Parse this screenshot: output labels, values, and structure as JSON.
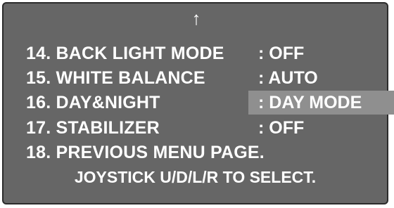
{
  "osd": {
    "scroll_indicator": "↑",
    "items": [
      {
        "label": "14. BACK LIGHT MODE",
        "value": ": OFF"
      },
      {
        "label": "15. WHITE BALANCE",
        "value": ": AUTO"
      },
      {
        "label": "16. DAY&NIGHT",
        "value": ": DAY MODE"
      },
      {
        "label": "17. STABILIZER",
        "value": ": OFF"
      },
      {
        "label": "18. PREVIOUS MENU PAGE.",
        "value": ""
      }
    ],
    "selected_index": 2,
    "hint": "JOYSTICK U/D/L/R TO SELECT."
  },
  "colors": {
    "background": "#666666",
    "highlight": "#8f8f8f",
    "text": "#ffffff"
  }
}
